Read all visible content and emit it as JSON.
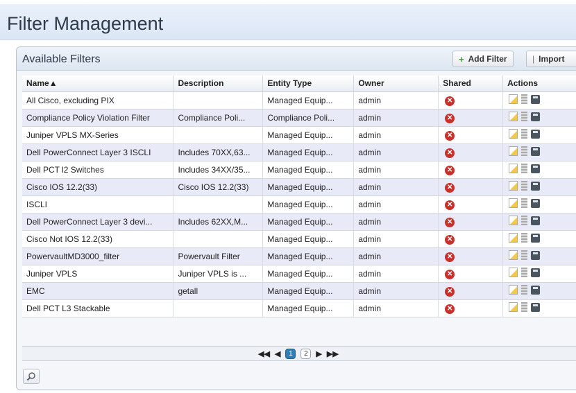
{
  "header": {
    "title": "Filter Management"
  },
  "panel": {
    "title": "Available Filters",
    "add_filter_label": "Add Filter",
    "import_label": "Import"
  },
  "table": {
    "columns": [
      "Name",
      "Description",
      "Entity Type",
      "Owner",
      "Shared",
      "Actions"
    ],
    "sort": {
      "column": "Name",
      "direction": "ascending",
      "indicator": "▲"
    },
    "rows": [
      {
        "name": "All Cisco, excluding PIX",
        "description": "",
        "entity_type": "Managed Equip...",
        "owner": "admin",
        "shared": false
      },
      {
        "name": "Compliance Policy Violation Filter",
        "description": "Compliance Poli...",
        "entity_type": "Compliance Poli...",
        "owner": "admin",
        "shared": false
      },
      {
        "name": "Juniper VPLS MX-Series",
        "description": "",
        "entity_type": "Managed Equip...",
        "owner": "admin",
        "shared": false
      },
      {
        "name": "Dell PowerConnect Layer 3 ISCLI",
        "description": "Includes 70XX,63...",
        "entity_type": "Managed Equip...",
        "owner": "admin",
        "shared": false
      },
      {
        "name": "Dell PCT l2 Switches",
        "description": "Includes 34XX/35...",
        "entity_type": "Managed Equip...",
        "owner": "admin",
        "shared": false
      },
      {
        "name": "Cisco IOS 12.2(33)",
        "description": "Cisco IOS 12.2(33)",
        "entity_type": "Managed Equip...",
        "owner": "admin",
        "shared": false
      },
      {
        "name": "ISCLI",
        "description": "",
        "entity_type": "Managed Equip...",
        "owner": "admin",
        "shared": false
      },
      {
        "name": "Dell PowerConnect Layer 3 devi...",
        "description": "Includes 62XX,M...",
        "entity_type": "Managed Equip...",
        "owner": "admin",
        "shared": false
      },
      {
        "name": "Cisco Not IOS 12.2(33)",
        "description": "",
        "entity_type": "Managed Equip...",
        "owner": "admin",
        "shared": false
      },
      {
        "name": "PowervaultMD3000_filter",
        "description": "Powervault Filter",
        "entity_type": "Managed Equip...",
        "owner": "admin",
        "shared": false
      },
      {
        "name": "Juniper VPLS",
        "description": "Juniper VPLS is ...",
        "entity_type": "Managed Equip...",
        "owner": "admin",
        "shared": false
      },
      {
        "name": "EMC",
        "description": "getall",
        "entity_type": "Managed Equip...",
        "owner": "admin",
        "shared": false
      },
      {
        "name": "Dell PCT L3 Stackable",
        "description": "",
        "entity_type": "Managed Equip...",
        "owner": "admin",
        "shared": false
      }
    ],
    "row_actions": [
      "edit-icon",
      "delete-icon",
      "save-icon"
    ],
    "shared_icon": "red-x-icon"
  },
  "pager": {
    "pages": [
      "1",
      "2"
    ],
    "current_page": "1",
    "controls": [
      "first",
      "previous",
      "next",
      "last"
    ]
  },
  "footer": {
    "search_icon": "search-icon"
  },
  "colors": {
    "header_bg": "#dbe6f6",
    "alt_row": "#e9eaf8",
    "active_page": "#2f7fb5",
    "shared_x": "#c9302c"
  }
}
